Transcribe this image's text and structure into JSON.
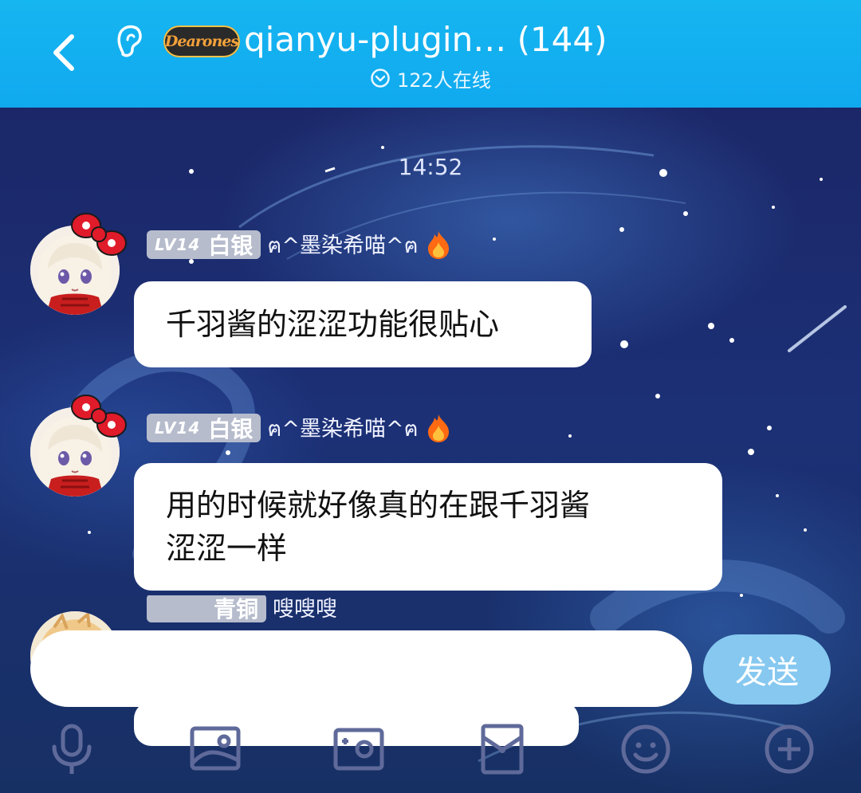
{
  "header": {
    "title": "qianyu-plugin… (144)",
    "logo_text": "Dearones",
    "online_text": "122人在线"
  },
  "chat": {
    "timestamp": "14:52",
    "messages": [
      {
        "level": "LV14",
        "rank": "白银",
        "nickname": "ฅ^墨染希喵^ฅ",
        "text": "千羽酱的涩涩功能很贴心"
      },
      {
        "level": "LV14",
        "rank": "白银",
        "nickname": "ฅ^墨染希喵^ฅ",
        "text_lines": [
          "用的时候就好像真的在跟千羽酱",
          "涩涩一样"
        ]
      }
    ],
    "partial_message": {
      "rank": "青铜",
      "nickname": "嗖嗖嗖"
    }
  },
  "input": {
    "value": "",
    "send_label": "发送"
  },
  "toolbar": {
    "items": [
      "mic-icon",
      "image-icon",
      "camera-icon",
      "red-packet-icon",
      "emoji-icon",
      "plus-icon"
    ]
  },
  "colors": {
    "header": "#10a9ef",
    "send_button": "#86c8f0",
    "badge": "#b6bccc"
  }
}
